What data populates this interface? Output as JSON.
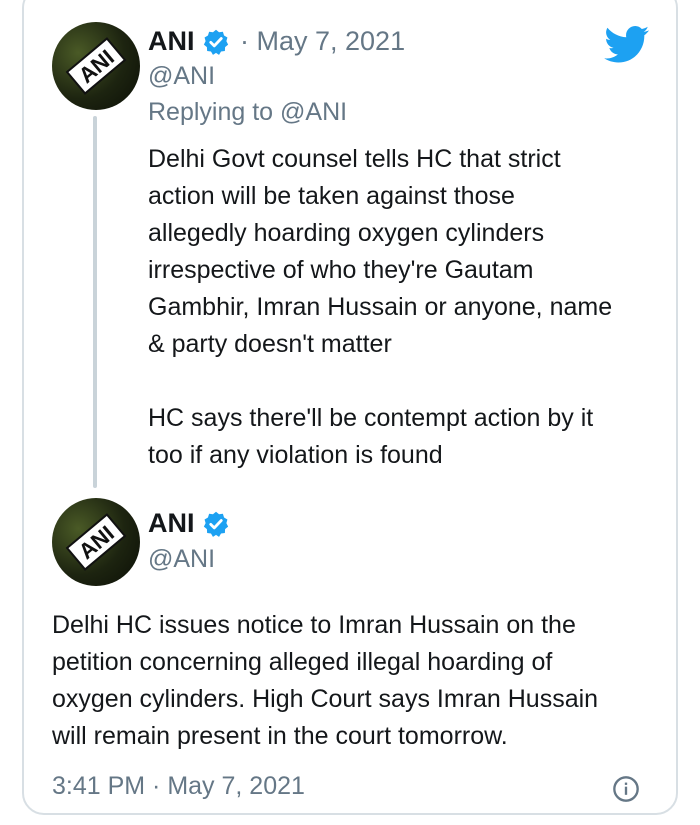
{
  "reply_tweet": {
    "author_name": "ANI",
    "date": "· May 7, 2021",
    "handle": "@ANI",
    "replying_prefix": "Replying to ",
    "replying_to": "@ANI",
    "text": "Delhi Govt counsel tells HC that strict\naction will be taken against those\nallegedly hoarding oxygen cylinders\nirrespective of who they're Gautam\nGambhir, Imran Hussain or anyone, name\n& party doesn't matter\n\nHC says there'll be contempt action by it\ntoo if any violation is found"
  },
  "quoted_tweet": {
    "author_name": "ANI",
    "handle": "@ANI",
    "text": "Delhi HC issues notice to Imran Hussain on the\npetition concerning alleged illegal hoarding of\noxygen cylinders. High Court says Imran Hussain\nwill remain present in the court tomorrow.",
    "timestamp": "3:41 PM · May 7, 2021"
  },
  "avatar_logo_text": "ANI",
  "icons": {
    "brand": "twitter-bird-icon",
    "verified": "verified-badge-icon",
    "info": "info-icon"
  },
  "colors": {
    "twitter_blue": "#1da1f2",
    "secondary_text": "#657786",
    "border": "#d8dfe4"
  }
}
